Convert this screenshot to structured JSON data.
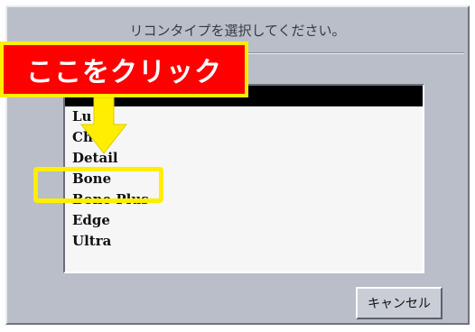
{
  "dialog": {
    "title": "リコンタイプを選択してください。",
    "list": {
      "items": [
        {
          "label": "",
          "selected": true
        },
        {
          "label": "Lu",
          "selected": false
        },
        {
          "label": "Ch",
          "selected": false
        },
        {
          "label": "Detail",
          "selected": false
        },
        {
          "label": "Bone",
          "selected": false
        },
        {
          "label": "Bone Plus",
          "selected": false
        },
        {
          "label": "Edge",
          "selected": false
        },
        {
          "label": "Ultra",
          "selected": false
        }
      ]
    },
    "cancel_label": "キャンセル"
  },
  "annotation": {
    "callout_text": "ここをクリック",
    "callout_color": "#ff0000",
    "highlight_color": "#ffee00",
    "arrow_icon": "arrow-down-icon"
  }
}
